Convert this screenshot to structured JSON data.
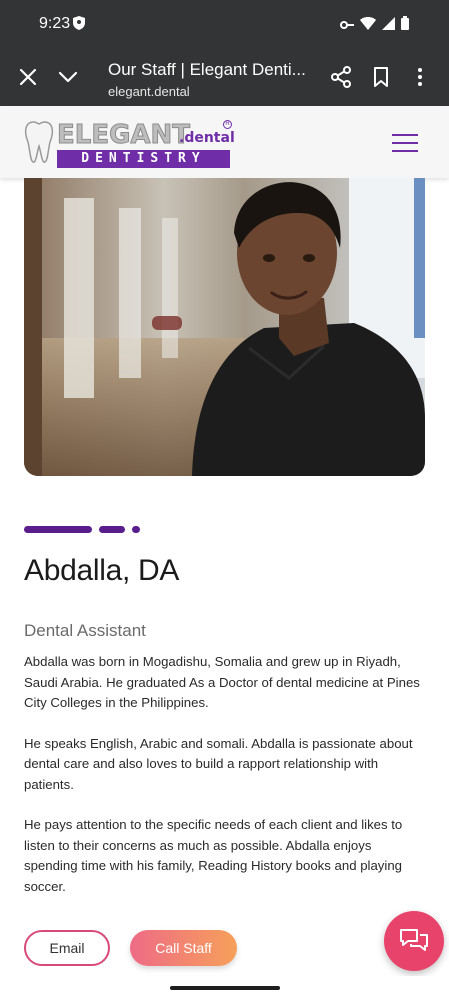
{
  "status_bar": {
    "time": "9:23"
  },
  "browser": {
    "page_title": "Our Staff | Elegant Denti...",
    "url": "elegant.dental"
  },
  "site": {
    "logo": {
      "top": "ELEGANT",
      "suffix": ".dental",
      "bar": "DENTISTRY",
      "reg": "R"
    }
  },
  "staff": {
    "name": "Abdalla, DA",
    "role": "Dental Assistant",
    "bio": [
      "Abdalla was born in Mogadishu, Somalia and grew up in Riyadh, Saudi Arabia. He graduated As a Doctor of dental medicine at Pines City Colleges in the Philippines.",
      "He speaks English, Arabic and somali. Abdalla is passionate about dental care and also loves to build a rapport relationship with patients.",
      "He pays attention to the specific needs of each client and likes to listen to their concerns as much as possible. Abdalla enjoys spending time with his family, Reading History books and playing soccer."
    ]
  },
  "actions": {
    "email_label": "Email",
    "call_label": "Call Staff"
  },
  "colors": {
    "brand_purple": "#6f2da8",
    "accent_pink": "#e8436a",
    "gradient_end": "#f6a05a",
    "dark_bar": "#333436"
  },
  "icons": {
    "close": "close-icon",
    "collapse": "chevron-down-icon",
    "share": "share-icon",
    "bookmark": "bookmark-icon",
    "more": "more-vert-icon",
    "menu": "hamburger-menu-icon",
    "chat": "chat-icon"
  }
}
